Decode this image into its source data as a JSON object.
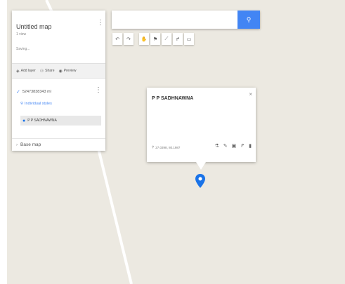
{
  "map": {
    "title": "Untitled map",
    "views": "1 view",
    "status": "Saving...",
    "actions": {
      "add_layer": "Add layer",
      "share": "Share",
      "preview": "Preview"
    },
    "layer": {
      "name": "52473838343 ml",
      "styles_link": "Individual styles",
      "place": "P P SADHNAWNA"
    },
    "base_map": "Base map"
  },
  "search": {
    "placeholder": "",
    "value": ""
  },
  "popup": {
    "title": "P P SADHNAWNA",
    "coords": "27.0398, 80.1987"
  },
  "colors": {
    "search_button": "#4285f4",
    "marker": "#1a73e8",
    "map_bg": "#ece9e1"
  },
  "icons": {
    "toolbar": [
      "undo-icon",
      "redo-icon",
      "hand-icon",
      "marker-icon",
      "shape-icon",
      "route-icon",
      "ruler-icon"
    ],
    "popup": [
      "paint-icon",
      "edit-icon",
      "camera-icon",
      "directions-icon",
      "delete-icon"
    ]
  }
}
